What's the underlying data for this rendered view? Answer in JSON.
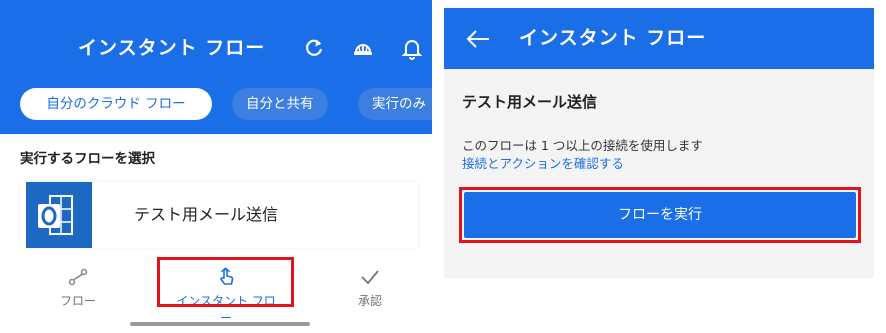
{
  "colors": {
    "accent": "#1a6ee8",
    "highlight": "#e1141b",
    "outlook": "#1c68c2"
  },
  "left": {
    "title": "インスタント フロー",
    "header_icons": [
      "refresh-icon",
      "hard-hat-icon",
      "bell-icon"
    ],
    "chips": [
      {
        "label": "自分のクラウド フロー",
        "active": true
      },
      {
        "label": "自分と共有",
        "active": false
      },
      {
        "label": "実行のみ",
        "active": false
      }
    ],
    "section_label": "実行するフローを選択",
    "flows": [
      {
        "name": "テスト用メール送信",
        "icon": "outlook-icon"
      }
    ],
    "tabs": [
      {
        "label": "フロー",
        "icon": "flow-icon",
        "active": false
      },
      {
        "label": "インスタント フロー",
        "icon": "touch-icon",
        "active": true
      },
      {
        "label": "承認",
        "icon": "check-icon",
        "active": false
      }
    ]
  },
  "right": {
    "title": "インスタント フロー",
    "flow_name": "テスト用メール送信",
    "description": "このフローは 1 つ以上の接続を使用します",
    "link": "接続とアクションを確認する",
    "run_button": "フローを実行"
  }
}
